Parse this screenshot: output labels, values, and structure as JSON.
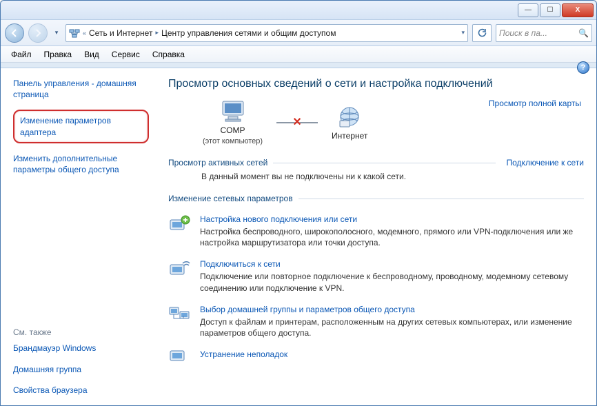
{
  "window": {
    "min_label": "—",
    "max_label": "☐",
    "close_label": "X"
  },
  "breadcrumbs": {
    "level1": "Сеть и Интернет",
    "level2": "Центр управления сетями и общим доступом"
  },
  "search": {
    "placeholder": "Поиск в па..."
  },
  "menu": {
    "file": "Файл",
    "edit": "Правка",
    "view": "Вид",
    "tools": "Сервис",
    "help": "Справка"
  },
  "sidebar": {
    "home": "Панель управления - домашняя страница",
    "adapter": "Изменение параметров адаптера",
    "sharing": "Изменить дополнительные параметры общего доступа",
    "see_also": "См. также",
    "firewall": "Брандмауэр Windows",
    "homegroup": "Домашняя группа",
    "browser_props": "Свойства браузера"
  },
  "content": {
    "heading": "Просмотр основных сведений о сети и настройка подключений",
    "full_map": "Просмотр полной карты",
    "node_comp": "COMP",
    "node_comp_sub": "(этот компьютер)",
    "node_internet": "Интернет",
    "active_title": "Просмотр активных сетей",
    "active_link": "Подключение к сети",
    "active_msg": "В данный момент вы не подключены ни к какой сети.",
    "change_title": "Изменение сетевых параметров",
    "task1_link": "Настройка нового подключения или сети",
    "task1_desc": "Настройка беспроводного, широкополосного, модемного, прямого или VPN-подключения или же настройка маршрутизатора или точки доступа.",
    "task2_link": "Подключиться к сети",
    "task2_desc": "Подключение или повторное подключение к беспроводному, проводному, модемному сетевому соединению или подключение к VPN.",
    "task3_link": "Выбор домашней группы и параметров общего доступа",
    "task3_desc": "Доступ к файлам и принтерам, расположенным на других сетевых компьютерах, или изменение параметров общего доступа.",
    "task4_link": "Устранение неполадок"
  }
}
